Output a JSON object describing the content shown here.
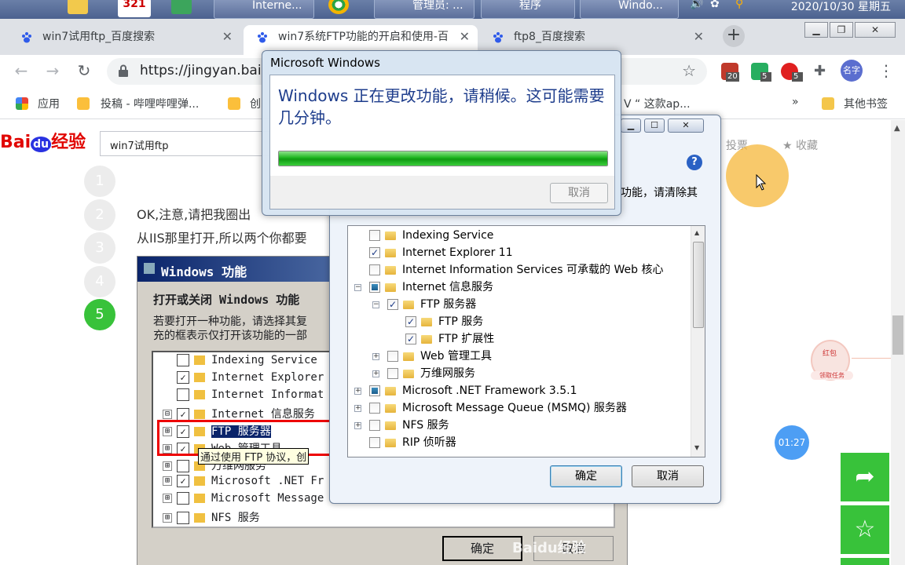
{
  "taskbar": {
    "items": [
      {
        "label": "321"
      },
      {
        "label": "Interne..."
      },
      {
        "label": "管理员: ..."
      },
      {
        "label": "程序"
      },
      {
        "label": "Windo..."
      }
    ],
    "clock": "2020/10/30 星期五"
  },
  "browser": {
    "tabs": [
      {
        "title": "win7试用ftp_百度搜索",
        "close": "✕"
      },
      {
        "title": "win7系统FTP功能的开启和使用-百",
        "close": "✕"
      },
      {
        "title": "ftp8_百度搜索",
        "close": "✕"
      }
    ],
    "new_tab": "+",
    "url": "https://jingyan.bai",
    "extensions": [
      {
        "badge": "20",
        "color": "#c0392b"
      },
      {
        "badge": "5",
        "color": "#27ae60"
      },
      {
        "badge": "5",
        "color": "#e02020"
      }
    ],
    "profile": "名字",
    "bookmarks": [
      {
        "label": "应用"
      },
      {
        "label": "投稿 - 哔哩哔哩弹..."
      },
      {
        "label": "创"
      },
      {
        "label": "V “ 这款ap..."
      },
      {
        "label": "»"
      },
      {
        "label": "其他书签"
      }
    ]
  },
  "page": {
    "logo_bai": "Bai",
    "logo_du": "du",
    "logo_jy": "经验",
    "search_value": "win7试用ftp",
    "links": {
      "vote": "投票",
      "fav": "收藏"
    },
    "steps": [
      "1",
      "2",
      "3",
      "4",
      "5"
    ],
    "para1": "OK,注意,请把我圈出",
    "para2": "从IIS那里打开,所以两个你都要",
    "embedded": {
      "title": "Windows 功能",
      "heading": "打开或关闭 Windows 功能",
      "desc1": "若要打开一种功能，请选择其复",
      "desc2": "充的框表示仅打开该功能的一部",
      "rows": [
        {
          "label": "Indexing Service",
          "pm": "",
          "check": ""
        },
        {
          "label": "Internet Explorer",
          "pm": "",
          "check": "✓"
        },
        {
          "label": "Internet Informat",
          "pm": "",
          "check": ""
        },
        {
          "label": "Internet 信息服务",
          "pm": "⊟",
          "check": "✓"
        },
        {
          "label": "FTP 服务器",
          "pm": "⊞",
          "check": "✓"
        },
        {
          "label": "Web 管理工具",
          "pm": "⊞",
          "check": "✓"
        },
        {
          "label": "万维网服务",
          "pm": "⊞",
          "check": ""
        },
        {
          "label": "Microsoft .NET Fr",
          "pm": "⊞",
          "check": "✓"
        },
        {
          "label": "Microsoft Message",
          "pm": "⊞",
          "check": ""
        },
        {
          "label": "NFS 服务",
          "pm": "⊞",
          "check": ""
        }
      ],
      "tooltip": "通过使用 FTP 协议，创",
      "ok": "确定",
      "cancel": "取消"
    },
    "watermark": "Baidu经验",
    "hongbao": {
      "label": "红包",
      "sub": "领取任务"
    },
    "timer": "01:27",
    "share_icon": "➦",
    "star_icon": "☆"
  },
  "features_dialog": {
    "desc": "功能，请清除其",
    "help": "?",
    "rows": [
      {
        "label": "Indexing Service",
        "state": "unchecked",
        "pm": "",
        "indent": 0
      },
      {
        "label": "Internet Explorer 11",
        "state": "checked",
        "pm": "",
        "indent": 0
      },
      {
        "label": "Internet Information Services 可承载的 Web 核心",
        "state": "unchecked",
        "pm": "",
        "indent": 0
      },
      {
        "label": "Internet 信息服务",
        "state": "partial",
        "pm": "−",
        "indent": 0
      },
      {
        "label": "FTP 服务器",
        "state": "checked",
        "pm": "−",
        "indent": 1
      },
      {
        "label": "FTP 服务",
        "state": "checked",
        "pm": "",
        "indent": 2
      },
      {
        "label": "FTP 扩展性",
        "state": "checked",
        "pm": "",
        "indent": 2
      },
      {
        "label": "Web 管理工具",
        "state": "unchecked",
        "pm": "+",
        "indent": 1
      },
      {
        "label": "万维网服务",
        "state": "unchecked",
        "pm": "+",
        "indent": 1
      },
      {
        "label": "Microsoft .NET Framework 3.5.1",
        "state": "partial",
        "pm": "+",
        "indent": 0
      },
      {
        "label": "Microsoft Message Queue (MSMQ) 服务器",
        "state": "unchecked",
        "pm": "+",
        "indent": 0
      },
      {
        "label": "NFS 服务",
        "state": "unchecked",
        "pm": "+",
        "indent": 0
      },
      {
        "label": "RIP 侦听器",
        "state": "unchecked",
        "pm": "",
        "indent": 0
      }
    ],
    "ok": "确定",
    "cancel": "取消"
  },
  "progress_dialog": {
    "title": "Microsoft Windows",
    "message": "Windows 正在更改功能，请稍候。这可能需要几分钟。",
    "progress": 1.0,
    "cancel": "取消"
  }
}
